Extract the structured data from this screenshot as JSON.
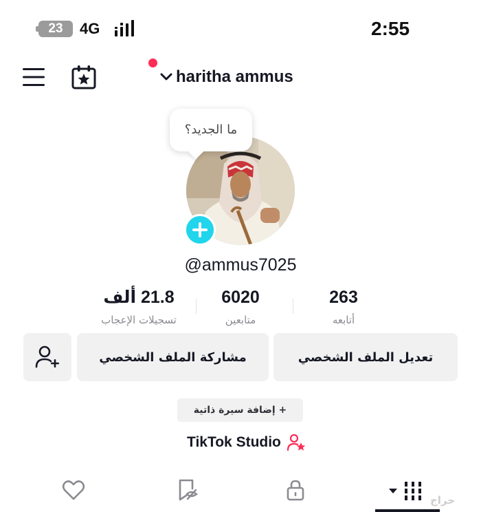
{
  "status_bar": {
    "battery": "23",
    "network": "4G",
    "time": "2:55"
  },
  "top_bar": {
    "username": "haritha ammus",
    "icons": [
      "menu-icon",
      "calendar-star-icon",
      "chevron-down-icon"
    ],
    "notification_dot_color": "#fe2c55"
  },
  "profile": {
    "bubble_text": "ما الجديد؟",
    "handle": "@ammus7025",
    "add_button_color": "#20d5ec"
  },
  "stats": {
    "likes_value": "21.8 ألف",
    "likes_label": "تسجيلات الإعجاب",
    "followers_value": "6020",
    "followers_label": "متابعين",
    "following_value": "263",
    "following_label": "أتابعه"
  },
  "actions": {
    "edit_profile": "تعديل الملف الشخصي",
    "share_profile": "مشاركة الملف الشخصي",
    "add_friends_icon": "person-plus-icon"
  },
  "bio": {
    "add_bio": "+ إضافة سيرة ذاتية"
  },
  "studio": {
    "label": "TikTok Studio",
    "icon_color": "#fe2c55"
  },
  "tabs": {
    "items": [
      "heart-icon",
      "bookmark-hidden-icon",
      "lock-icon",
      "grid-icon"
    ],
    "active": "grid-icon"
  },
  "watermark": "حراج"
}
